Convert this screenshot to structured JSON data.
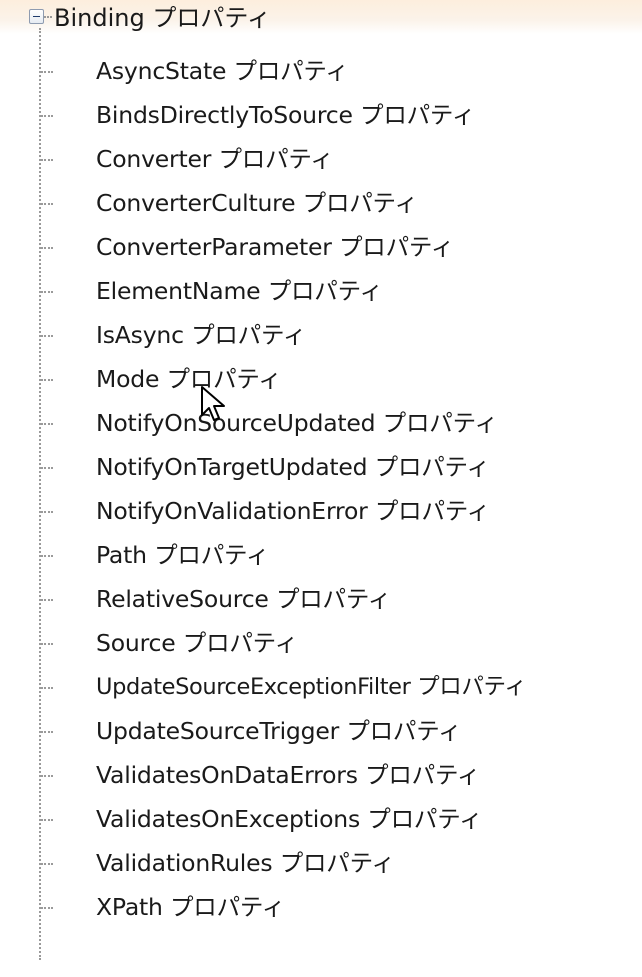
{
  "root": {
    "label": "Binding プロパティ",
    "expanded": true
  },
  "items": [
    {
      "label": "AsyncState プロパティ"
    },
    {
      "label": "BindsDirectlyToSource プロパティ"
    },
    {
      "label": "Converter プロパティ"
    },
    {
      "label": "ConverterCulture プロパティ"
    },
    {
      "label": "ConverterParameter プロパティ"
    },
    {
      "label": "ElementName プロパティ"
    },
    {
      "label": "IsAsync プロパティ"
    },
    {
      "label": "Mode プロパティ"
    },
    {
      "label": "NotifyOnSourceUpdated プロパティ"
    },
    {
      "label": "NotifyOnTargetUpdated プロパティ"
    },
    {
      "label": "NotifyOnValidationError プロパティ"
    },
    {
      "label": "Path プロパティ"
    },
    {
      "label": "RelativeSource プロパティ"
    },
    {
      "label": "Source プロパティ"
    },
    {
      "label": "UpdateSourceExceptionFilter プロパティ"
    },
    {
      "label": "UpdateSourceTrigger プロパティ"
    },
    {
      "label": "ValidatesOnDataErrors プロパティ"
    },
    {
      "label": "ValidatesOnExceptions プロパティ"
    },
    {
      "label": "ValidationRules プロパティ"
    },
    {
      "label": "XPath プロパティ"
    }
  ],
  "icons": {
    "expander": "collapse-minus-icon",
    "cursor": "mouse-pointer-icon"
  }
}
